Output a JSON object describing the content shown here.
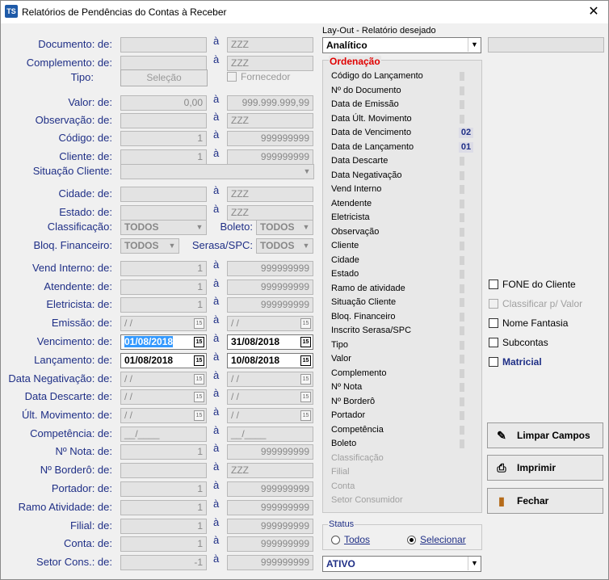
{
  "window": {
    "icon_text": "TS",
    "title": "Relatórios de Pendências do Contas à Receber",
    "close_label": "✕"
  },
  "a_label": "à",
  "left_rows": [
    {
      "label": "Documento: de:",
      "from": "",
      "to": "ZZZ"
    },
    {
      "label": "Complemento: de:",
      "from": "",
      "to": "ZZZ"
    },
    {
      "label": "Valor: de:",
      "from": "0,00",
      "to": "999.999.999,99"
    },
    {
      "label": "Observação: de:",
      "from": "",
      "to": "ZZZ"
    },
    {
      "label": "Código: de:",
      "from": "1",
      "to": "999999999"
    },
    {
      "label": "Cliente: de:",
      "from": "1",
      "to": "999999999"
    },
    {
      "label": "Cidade: de:",
      "from": "",
      "to": "ZZZ"
    },
    {
      "label": "Estado: de:",
      "from": "",
      "to": "ZZZ"
    },
    {
      "label": "Vend Interno: de:",
      "from": "1",
      "to": "999999999"
    },
    {
      "label": "Atendente: de:",
      "from": "1",
      "to": "999999999"
    },
    {
      "label": "Eletricista: de:",
      "from": "1",
      "to": "999999999"
    },
    {
      "label": "Emissão: de:",
      "from": " / /",
      "to": " / /"
    },
    {
      "label": "Vencimento: de:",
      "from": "01/08/2018",
      "to": "31/08/2018"
    },
    {
      "label": "Lançamento: de:",
      "from": "01/08/2018",
      "to": "10/08/2018"
    },
    {
      "label": "Data Negativação: de:",
      "from": " / /",
      "to": " / /"
    },
    {
      "label": "Data Descarte: de:",
      "from": " / /",
      "to": " / /"
    },
    {
      "label": "Últ. Movimento: de:",
      "from": " / /",
      "to": " / /"
    },
    {
      "label": "Competência: de:",
      "from": "__/____",
      "to": "__/____"
    },
    {
      "label": "Nº Nota: de:",
      "from": "1",
      "to": "999999999"
    },
    {
      "label": "Nº Borderô: de:",
      "from": "",
      "to": "ZZZ"
    },
    {
      "label": "Portador: de:",
      "from": "1",
      "to": "999999999"
    },
    {
      "label": "Ramo Atividade: de:",
      "from": "1",
      "to": "999999999"
    },
    {
      "label": "Filial: de:",
      "from": "1",
      "to": "999999999"
    },
    {
      "label": "Conta: de:",
      "from": "1",
      "to": "999999999"
    },
    {
      "label": "Setor Cons.: de:",
      "from": "-1",
      "to": "999999999"
    }
  ],
  "tipo": {
    "label": "Tipo:",
    "button": "Seleção",
    "fornecedor": "Fornecedor"
  },
  "situacao": {
    "label": "Situação Cliente:",
    "value": ""
  },
  "classificacao": {
    "label": "Classificação:",
    "value": "TODOS"
  },
  "boleto": {
    "label": "Boleto:",
    "value": "TODOS"
  },
  "bloq": {
    "label": "Bloq. Financeiro:",
    "value": "TODOS"
  },
  "serasa": {
    "label": "Serasa/SPC:",
    "value": "TODOS"
  },
  "layout": {
    "label": "Lay-Out - Relatório desejado",
    "value": "Analítico",
    "extra": ""
  },
  "ordenacao": {
    "title": "Ordenação",
    "items": [
      {
        "label": "Código do Lançamento",
        "order": ""
      },
      {
        "label": "Nº do Documento",
        "order": ""
      },
      {
        "label": "Data de Emissão",
        "order": ""
      },
      {
        "label": "Data Últ. Movimento",
        "order": ""
      },
      {
        "label": "Data de Vencimento",
        "order": "02"
      },
      {
        "label": "Data de Lançamento",
        "order": "01"
      },
      {
        "label": "Data Descarte",
        "order": ""
      },
      {
        "label": "Data Negativação",
        "order": ""
      },
      {
        "label": "Vend Interno",
        "order": ""
      },
      {
        "label": "Atendente",
        "order": ""
      },
      {
        "label": "Eletricista",
        "order": ""
      },
      {
        "label": "Observação",
        "order": ""
      },
      {
        "label": "Cliente",
        "order": ""
      },
      {
        "label": "Cidade",
        "order": ""
      },
      {
        "label": "Estado",
        "order": ""
      },
      {
        "label": "Ramo de atividade",
        "order": ""
      },
      {
        "label": "Situação Cliente",
        "order": ""
      },
      {
        "label": "Bloq. Financeiro",
        "order": ""
      },
      {
        "label": "Inscrito Serasa/SPC",
        "order": ""
      },
      {
        "label": "Tipo",
        "order": ""
      },
      {
        "label": "Valor",
        "order": ""
      },
      {
        "label": "Complemento",
        "order": ""
      },
      {
        "label": "Nº Nota",
        "order": ""
      },
      {
        "label": "Nº Borderô",
        "order": ""
      },
      {
        "label": "Portador",
        "order": ""
      },
      {
        "label": "Competência",
        "order": ""
      },
      {
        "label": "Boleto",
        "order": ""
      },
      {
        "label": "Classificação",
        "order": ""
      },
      {
        "label": "Filial",
        "order": ""
      },
      {
        "label": "Conta",
        "order": ""
      },
      {
        "label": "Setor Consumidor",
        "order": ""
      }
    ]
  },
  "options": {
    "fone": "FONE do Cliente",
    "classificar": "Classificar p/ Valor",
    "fantasia": "Nome Fantasia",
    "subcontas": "Subcontas",
    "matricial": "Matricial"
  },
  "buttons": {
    "limpar": "Limpar Campos",
    "imprimir": "Imprimir",
    "fechar": "Fechar"
  },
  "status": {
    "title": "Status",
    "todos": "Todos",
    "selecionar": "Selecionar",
    "value": "ATIVO"
  },
  "colors": {
    "label": "#1f2f86",
    "ordem_title": "#e00000"
  }
}
